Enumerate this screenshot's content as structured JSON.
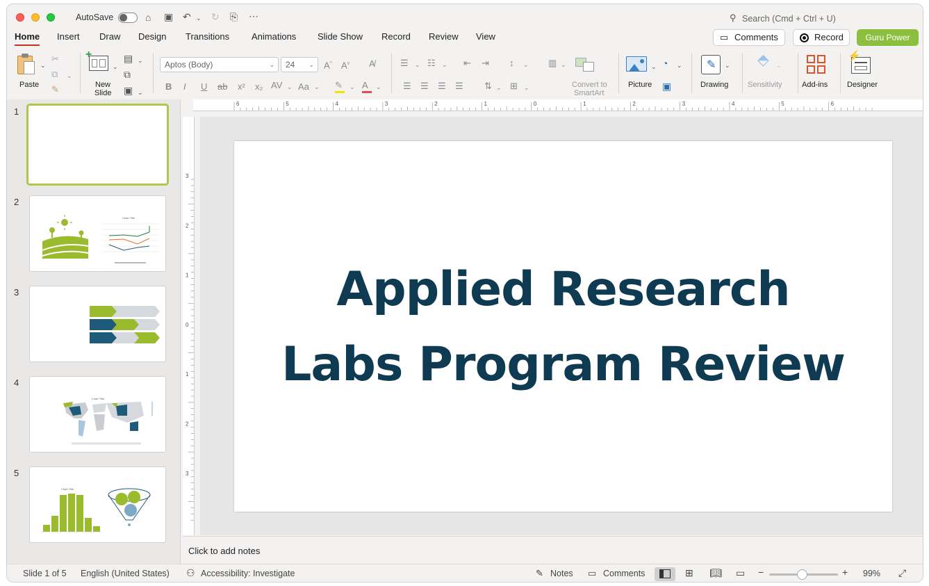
{
  "titlebar": {
    "autosave_label": "AutoSave",
    "search_placeholder": "Search (Cmd + Ctrl + U)"
  },
  "tabs": [
    "Home",
    "Insert",
    "Draw",
    "Design",
    "Transitions",
    "Animations",
    "Slide Show",
    "Record",
    "Review",
    "View"
  ],
  "header_buttons": {
    "comments": "Comments",
    "record": "Record",
    "guru": "Guru Power"
  },
  "ribbon": {
    "paste": "Paste",
    "new_slide_1": "New",
    "new_slide_2": "Slide",
    "font_name": "Aptos (Body)",
    "font_size": "24",
    "convert_1": "Convert to",
    "convert_2": "SmartArt",
    "picture": "Picture",
    "drawing": "Drawing",
    "sensitivity": "Sensitivity",
    "addins": "Add-ins",
    "designer": "Designer"
  },
  "slides": [
    {
      "num": "1"
    },
    {
      "num": "2",
      "chart_title": "Chart Title"
    },
    {
      "num": "3"
    },
    {
      "num": "4",
      "chart_title": "Chart Title"
    },
    {
      "num": "5",
      "chart_title": "Chart Title"
    }
  ],
  "ruler_h": [
    "6",
    "5",
    "4",
    "3",
    "2",
    "1",
    "0",
    "1",
    "2",
    "3",
    "4",
    "5",
    "6"
  ],
  "ruler_v": [
    "3",
    "2",
    "1",
    "0",
    "1",
    "2",
    "3"
  ],
  "slide_title": {
    "line1": "Applied Research",
    "line2": "Labs Program Review"
  },
  "notes_placeholder": "Click to add notes",
  "status": {
    "slide_of": "Slide 1 of 5",
    "language": "English (United States)",
    "accessibility": "Accessibility: Investigate",
    "notes": "Notes",
    "comments": "Comments",
    "zoom": "99%"
  },
  "colors": {
    "accent": "#c5302a",
    "guru": "#8cbf3f",
    "title": "#0e3a52",
    "green": "#9bbb2e",
    "blue": "#1e5a7a",
    "grey": "#d5d8dc"
  }
}
